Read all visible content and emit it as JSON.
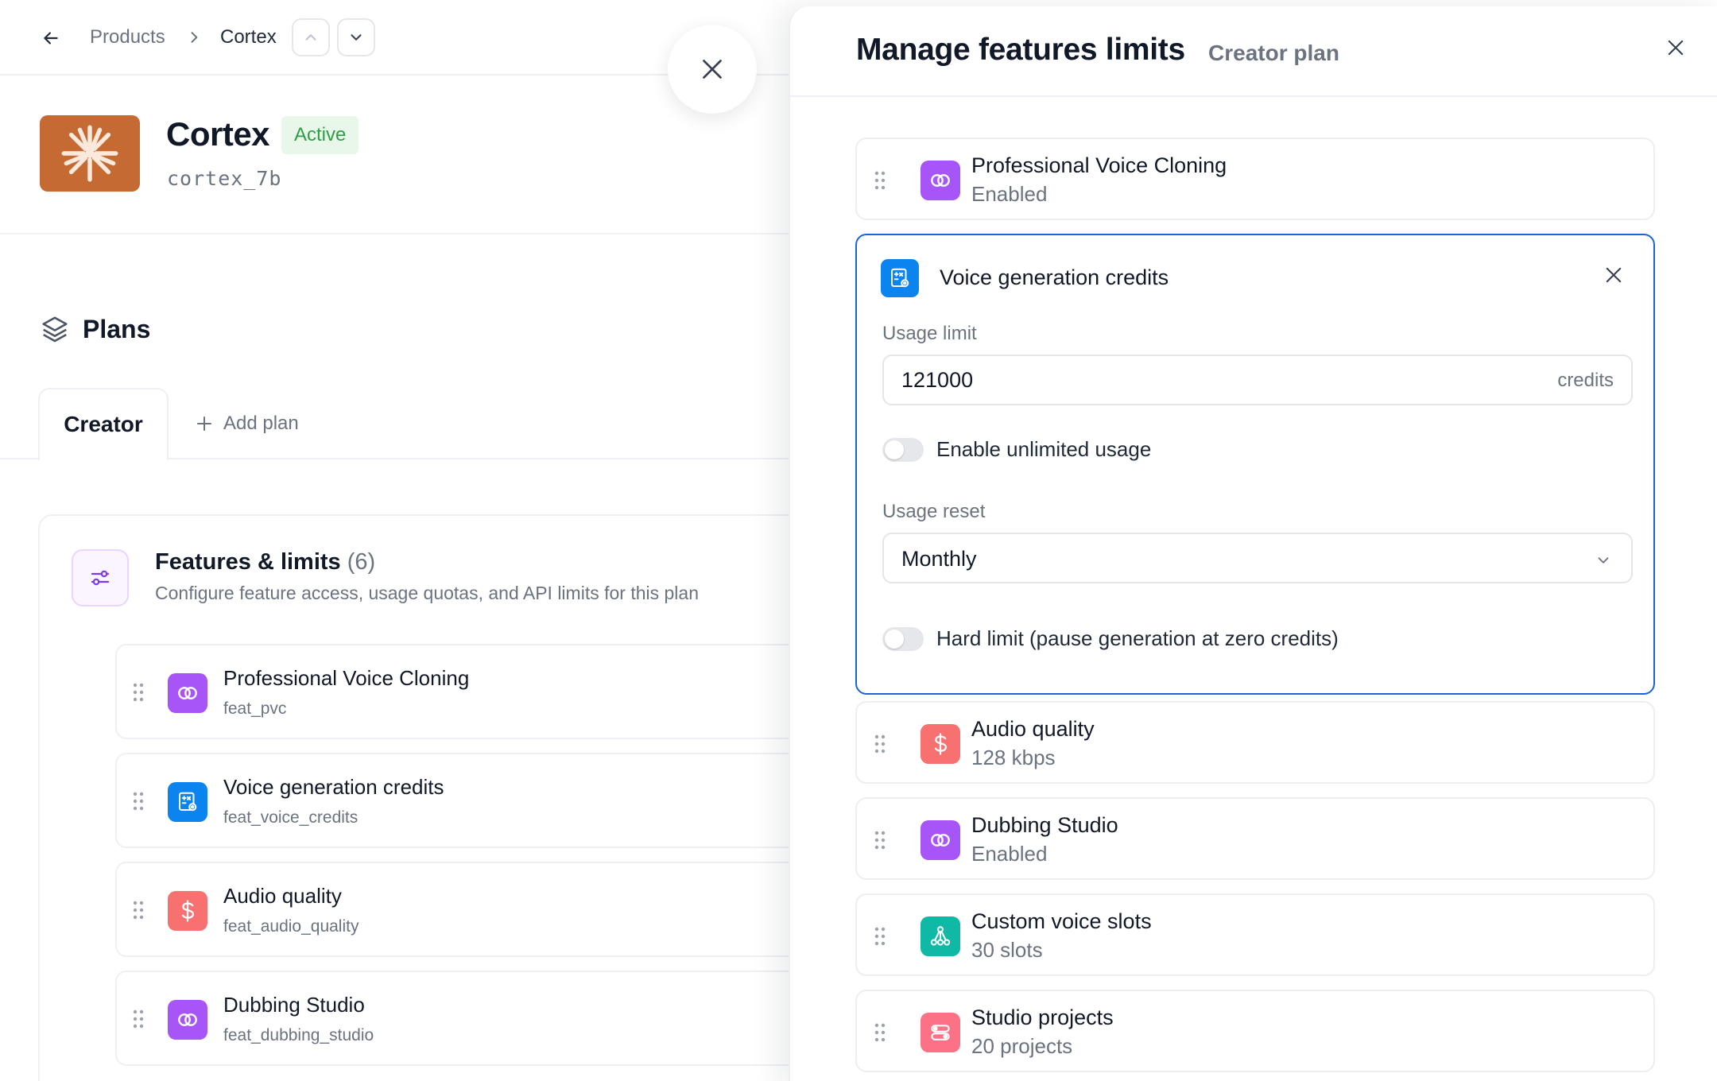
{
  "topbar": {
    "breadcrumb_parent": "Products",
    "breadcrumb_current": "Cortex"
  },
  "product": {
    "name": "Cortex",
    "status": "Active",
    "id": "cortex_7b"
  },
  "plans": {
    "heading": "Plans",
    "tabs": [
      {
        "label": "Creator"
      }
    ],
    "add_plan_label": "Add plan"
  },
  "features_section": {
    "title": "Features & limits",
    "count": "(6)",
    "subtitle": "Configure feature access, usage quotas, and API limits for this plan",
    "items": [
      {
        "name": "Professional Voice Cloning",
        "key": "feat_pvc",
        "icon": "voice-cloning-icon"
      },
      {
        "name": "Voice generation credits",
        "key": "feat_voice_credits",
        "icon": "calculator-settings-icon"
      },
      {
        "name": "Audio quality",
        "key": "feat_audio_quality",
        "icon": "dollar-icon"
      },
      {
        "name": "Dubbing Studio",
        "key": "feat_dubbing_studio",
        "icon": "voice-cloning-icon"
      }
    ]
  },
  "drawer": {
    "title": "Manage features limits",
    "subtitle": "Creator plan",
    "rows": [
      {
        "name": "Professional Voice Cloning",
        "value": "Enabled",
        "icon": "voice-cloning-icon"
      },
      {
        "name": "Audio quality",
        "value": "128 kbps",
        "icon": "dollar-icon"
      },
      {
        "name": "Dubbing Studio",
        "value": "Enabled",
        "icon": "voice-cloning-icon"
      },
      {
        "name": "Custom voice slots",
        "value": "30 slots",
        "icon": "network-icon"
      },
      {
        "name": "Studio projects",
        "value": "20 projects",
        "icon": "toggles-icon"
      }
    ],
    "editing": {
      "name": "Voice generation credits",
      "usage_limit_label": "Usage limit",
      "usage_limit_value": "121000",
      "usage_limit_unit": "credits",
      "unlimited_label": "Enable unlimited usage",
      "unlimited_enabled": false,
      "reset_label": "Usage reset",
      "reset_value": "Monthly",
      "hard_limit_label": "Hard limit (pause generation at zero credits)",
      "hard_limit_enabled": false
    }
  },
  "colors": {
    "accent_blue": "#1d63d8",
    "active_badge_bg": "#e8f7ea",
    "active_badge_text": "#2f9e44",
    "logo_bg": "#c66a34",
    "icon_purple": "#a855f7",
    "icon_blue": "#0b84f0",
    "icon_red": "#f87171",
    "icon_teal": "#10b9a5",
    "icon_pink": "#fb7185"
  }
}
